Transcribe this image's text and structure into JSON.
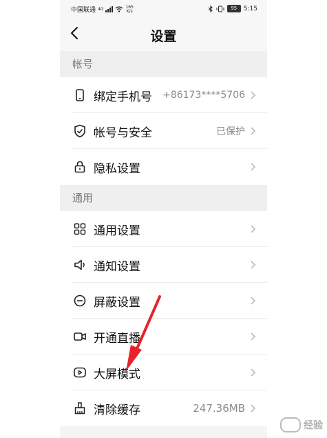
{
  "statusbar": {
    "carrier": "中国联通",
    "signal": "4G",
    "net_speed_value": "165",
    "net_speed_unit": "K/s",
    "battery": "95",
    "time": "5:15"
  },
  "header": {
    "title": "设置"
  },
  "sections": [
    {
      "title": "帐号",
      "items": [
        {
          "label": "绑定手机号",
          "value": "+86173****5706",
          "icon": "phone-icon"
        },
        {
          "label": "帐号与安全",
          "value": "已保护",
          "icon": "shield-check-icon"
        },
        {
          "label": "隐私设置",
          "value": "",
          "icon": "lock-icon"
        }
      ]
    },
    {
      "title": "通用",
      "items": [
        {
          "label": "通用设置",
          "value": "",
          "icon": "grid-icon"
        },
        {
          "label": "通知设置",
          "value": "",
          "icon": "speaker-icon"
        },
        {
          "label": "屏蔽设置",
          "value": "",
          "icon": "block-icon"
        },
        {
          "label": "开通直播",
          "value": "",
          "icon": "video-camera-icon"
        },
        {
          "label": "大屏模式",
          "value": "",
          "icon": "play-screen-icon"
        },
        {
          "label": "清除缓存",
          "value": "247.36MB",
          "icon": "broom-icon"
        }
      ]
    }
  ],
  "watermark": {
    "text": "经验"
  },
  "colors": {
    "annotation_arrow": "#e8222a"
  }
}
